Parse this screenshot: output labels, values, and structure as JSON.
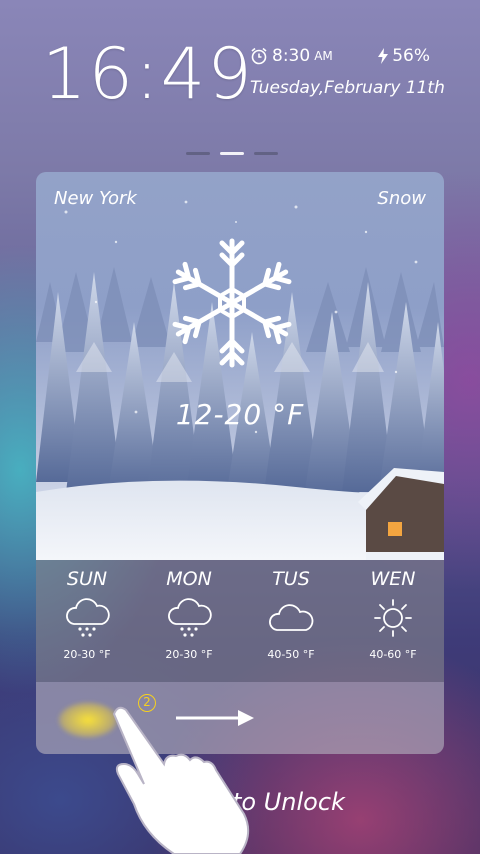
{
  "status": {
    "time": "16:49",
    "alarm_time": "8:30",
    "alarm_ampm": "AM",
    "battery": "56%",
    "date": "Tuesday,February 11th"
  },
  "weather": {
    "city": "New York",
    "condition": "Snow",
    "temperature": "12-20 °F",
    "icon": "snowflake-icon"
  },
  "forecast": [
    {
      "day": "SUN",
      "range": "20-30 °F",
      "icon": "rain-cloud-icon"
    },
    {
      "day": "MON",
      "range": "20-30 °F",
      "icon": "rain-cloud-icon"
    },
    {
      "day": "TUS",
      "range": "40-50 °F",
      "icon": "cloud-icon"
    },
    {
      "day": "WEN",
      "range": "40-60 °F",
      "icon": "sun-icon"
    }
  ],
  "unlock": {
    "step_number": "2",
    "hint": "to Unlock"
  },
  "colors": {
    "accent_yellow": "#f5d020",
    "text": "#ffffff"
  }
}
